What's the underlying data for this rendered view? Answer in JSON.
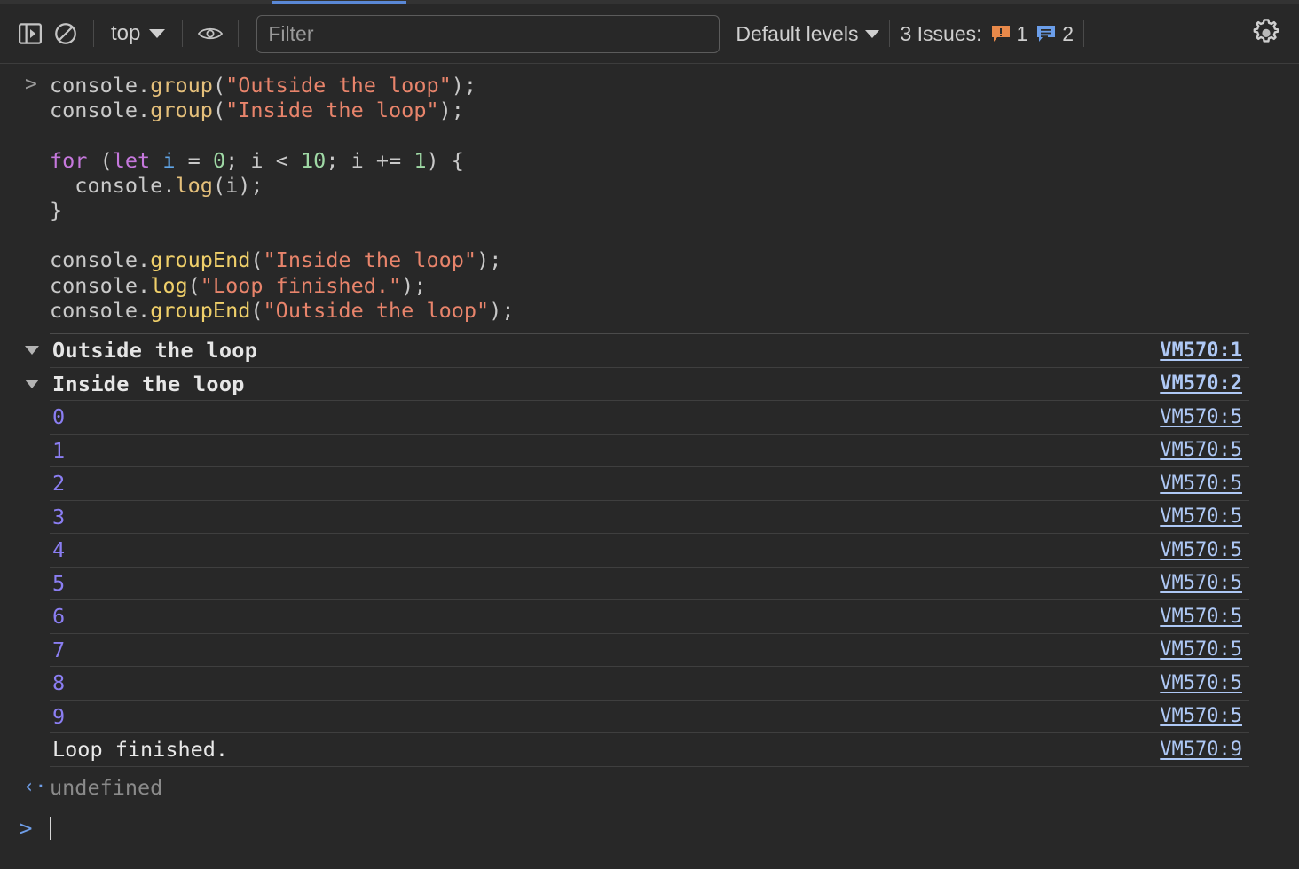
{
  "toolbar": {
    "sidebar_toggle": "toggle-console-sidebar",
    "clear_console": "clear-console",
    "context_label": "top",
    "eye_label": "live-expressions",
    "filter_placeholder": "Filter",
    "filter_value": "",
    "levels_label": "Default levels",
    "issues_label": "3 Issues:",
    "issues_error_count": "1",
    "issues_info_count": "2",
    "settings_label": "console-settings",
    "accent_color": "#5a88d6",
    "issue_error_color": "#e8894a",
    "issue_info_color": "#6b9eea"
  },
  "code": {
    "prompt_arrow": ">",
    "lines": [
      [
        {
          "t": "console.",
          "c": "plain"
        },
        {
          "t": "group",
          "c": "fn"
        },
        {
          "t": "(",
          "c": "plain"
        },
        {
          "t": "\"Outside the loop\"",
          "c": "str"
        },
        {
          "t": ");",
          "c": "plain"
        }
      ],
      [
        {
          "t": "console.",
          "c": "plain"
        },
        {
          "t": "group",
          "c": "fn"
        },
        {
          "t": "(",
          "c": "plain"
        },
        {
          "t": "\"Inside the loop\"",
          "c": "str"
        },
        {
          "t": ");",
          "c": "plain"
        }
      ],
      [],
      [
        {
          "t": "for",
          "c": "kw"
        },
        {
          "t": " (",
          "c": "plain"
        },
        {
          "t": "let",
          "c": "kw"
        },
        {
          "t": " ",
          "c": "plain"
        },
        {
          "t": "i",
          "c": "var"
        },
        {
          "t": " = ",
          "c": "plain"
        },
        {
          "t": "0",
          "c": "num"
        },
        {
          "t": "; i < ",
          "c": "plain"
        },
        {
          "t": "10",
          "c": "num"
        },
        {
          "t": "; i += ",
          "c": "plain"
        },
        {
          "t": "1",
          "c": "num"
        },
        {
          "t": ") {",
          "c": "plain"
        }
      ],
      [
        {
          "t": "  console.",
          "c": "plain"
        },
        {
          "t": "log",
          "c": "fn"
        },
        {
          "t": "(i);",
          "c": "plain"
        }
      ],
      [
        {
          "t": "}",
          "c": "plain"
        }
      ],
      [],
      [
        {
          "t": "console.",
          "c": "plain"
        },
        {
          "t": "groupEnd",
          "c": "fnb"
        },
        {
          "t": "(",
          "c": "plain"
        },
        {
          "t": "\"Inside the loop\"",
          "c": "str"
        },
        {
          "t": ");",
          "c": "plain"
        }
      ],
      [
        {
          "t": "console.",
          "c": "plain"
        },
        {
          "t": "log",
          "c": "fnb"
        },
        {
          "t": "(",
          "c": "plain"
        },
        {
          "t": "\"Loop finished.\"",
          "c": "str"
        },
        {
          "t": ");",
          "c": "plain"
        }
      ],
      [
        {
          "t": "console.",
          "c": "plain"
        },
        {
          "t": "groupEnd",
          "c": "fnb"
        },
        {
          "t": "(",
          "c": "plain"
        },
        {
          "t": "\"Outside the loop\"",
          "c": "str"
        },
        {
          "t": ");",
          "c": "plain"
        }
      ]
    ]
  },
  "log_rows": [
    {
      "kind": "group",
      "text": "Outside the loop",
      "source": "VM570:1",
      "expanded": true
    },
    {
      "kind": "group",
      "text": "Inside the loop",
      "source": "VM570:2",
      "expanded": true
    },
    {
      "kind": "number",
      "text": "0",
      "source": "VM570:5"
    },
    {
      "kind": "number",
      "text": "1",
      "source": "VM570:5"
    },
    {
      "kind": "number",
      "text": "2",
      "source": "VM570:5"
    },
    {
      "kind": "number",
      "text": "3",
      "source": "VM570:5"
    },
    {
      "kind": "number",
      "text": "4",
      "source": "VM570:5"
    },
    {
      "kind": "number",
      "text": "5",
      "source": "VM570:5"
    },
    {
      "kind": "number",
      "text": "6",
      "source": "VM570:5"
    },
    {
      "kind": "number",
      "text": "7",
      "source": "VM570:5"
    },
    {
      "kind": "number",
      "text": "8",
      "source": "VM570:5"
    },
    {
      "kind": "number",
      "text": "9",
      "source": "VM570:5"
    },
    {
      "kind": "message",
      "text": "Loop finished.",
      "source": "VM570:9"
    }
  ],
  "result": {
    "arrow": "‹·",
    "value": "undefined"
  },
  "prompt": {
    "arrow": ">",
    "value": ""
  }
}
